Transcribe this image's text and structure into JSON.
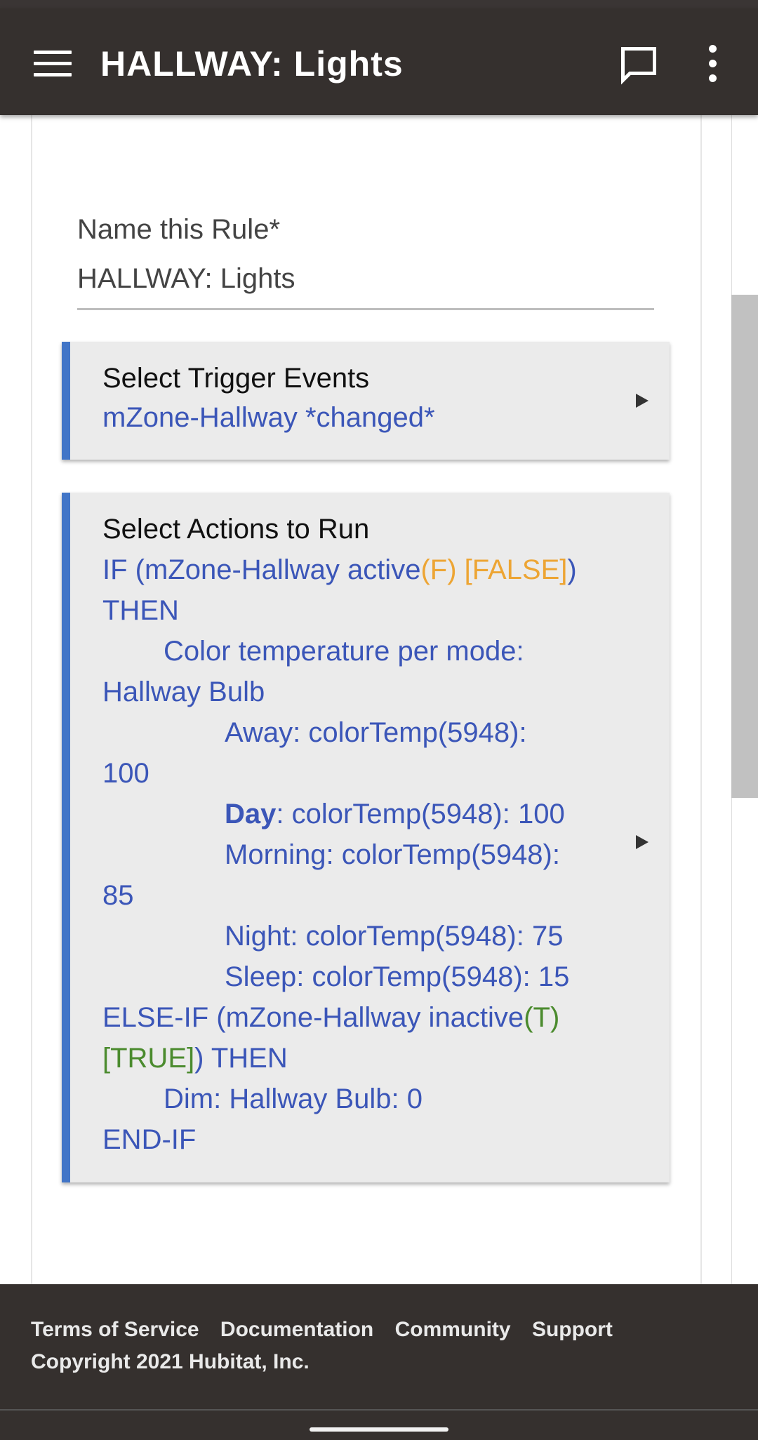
{
  "appbar": {
    "title": "HALLWAY: Lights",
    "menu_icon": "hamburger-menu-icon",
    "chat_icon": "chat-bubble-icon",
    "more_icon": "more-vertical-icon"
  },
  "rule_name": {
    "label": "Name this Rule*",
    "value": "HALLWAY: Lights"
  },
  "trigger_card": {
    "title": "Select Trigger Events",
    "summary": "mZone-Hallway *changed*"
  },
  "actions_card": {
    "title": "Select Actions to Run",
    "if_prefix": "IF (mZone-Hallway active",
    "if_flag": "(F) [FALSE]",
    "if_close": ")",
    "then_1": "THEN",
    "ct_header_1": "Color temperature per mode:",
    "ct_header_2": "Hallway Bulb",
    "away_1": "Away: colorTemp(5948):",
    "away_2": "100",
    "day_mode": "Day",
    "day_rest": ": colorTemp(5948): 100",
    "morning_1": "Morning: colorTemp(5948):",
    "morning_2": "85",
    "night": "Night: colorTemp(5948): 75",
    "sleep": "Sleep: colorTemp(5948): 15",
    "elseif_prefix": "ELSE-IF (mZone-Hallway inactive",
    "elseif_flag_1": "(T)",
    "elseif_flag_2": "[TRUE]",
    "elseif_close": ") THEN",
    "dim": "Dim: Hallway Bulb: 0",
    "endif": "END-IF"
  },
  "footer": {
    "links": [
      "Terms of Service",
      "Documentation",
      "Community",
      "Support"
    ],
    "copyright": "Copyright 2021 Hubitat, Inc."
  },
  "colors": {
    "appbar": "#35302e",
    "accent_bar": "#4175c7",
    "action_text": "#3b56b8",
    "false_flag": "#eda534",
    "true_flag": "#4b8b2e"
  }
}
